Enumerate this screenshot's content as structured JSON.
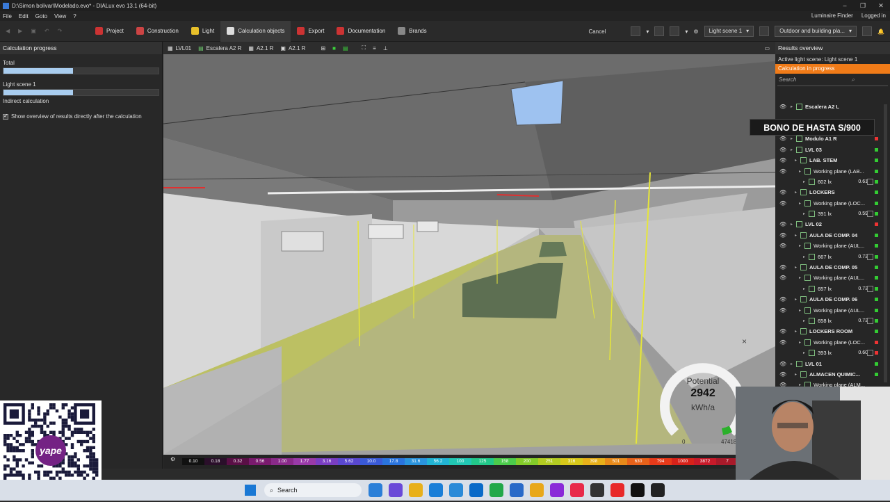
{
  "window": {
    "title": "D:\\Simon bolivar\\Modelado.evo* - DIALux evo 13.1  (64-bit)",
    "controls": [
      "–",
      "❐",
      "✕"
    ]
  },
  "menu": {
    "items": [
      "File",
      "Edit",
      "Goto",
      "View",
      "?"
    ],
    "luminaire_finder": "Luminaire Finder",
    "logged_in": "Logged in"
  },
  "toolbar": {
    "tabs": [
      {
        "label": "Project",
        "color": "#cc3333"
      },
      {
        "label": "Construction",
        "color": "#cc4444"
      },
      {
        "label": "Light",
        "color": "#e8c02a"
      },
      {
        "label": "Calculation objects",
        "color": "#dddddd"
      },
      {
        "label": "Export",
        "color": "#cc3333"
      },
      {
        "label": "Documentation",
        "color": "#cc3333"
      },
      {
        "label": "Brands",
        "color": "#888888"
      }
    ],
    "active_tab": "Calculation objects",
    "cancel": "Cancel",
    "light_scene": "Light scene 1",
    "outdoor": "Outdoor and building pla..."
  },
  "left_panel": {
    "title": "Calculation progress",
    "total_label": "Total",
    "total_progress": 0.45,
    "light_scene_label": "Light scene 1",
    "light_scene_progress": 0.45,
    "indirect_label": "Indirect calculation",
    "checkbox_label": "Show overview of results directly after the calculation"
  },
  "viewport": {
    "chips": [
      "LVL01",
      "Escalera A2 R",
      "A2.1 R",
      "A2.1 R"
    ],
    "close_glyph": "×"
  },
  "gauge": {
    "label": "Potential",
    "value": "2942",
    "unit": "kWh/a",
    "min": "0",
    "max": "47418"
  },
  "colorbar": {
    "values": [
      "0.10",
      "0.18",
      "0.32",
      "0.56",
      "1.00",
      "1.77",
      "3.16",
      "5.62",
      "10.0",
      "17.8",
      "31.6",
      "56.2",
      "100",
      "125",
      "158",
      "200",
      "251",
      "316",
      "398",
      "501",
      "630",
      "794",
      "1000",
      "3872",
      "7"
    ],
    "colors": [
      "#111111",
      "#2a0f2a",
      "#5a0f46",
      "#7a1a6e",
      "#8a2a8a",
      "#9a3aa8",
      "#7a3ec2",
      "#5a48d0",
      "#3a5ad8",
      "#2a74de",
      "#2a94de",
      "#22b4d4",
      "#22c8b4",
      "#22c88a",
      "#4ccc4c",
      "#84cc2a",
      "#b4cc22",
      "#d8c81a",
      "#e8b01a",
      "#e88a1a",
      "#e8621a",
      "#e83a1a",
      "#d8221a",
      "#c81a2a",
      "#a81a2a"
    ]
  },
  "right_panel": {
    "title": "Results overview",
    "active_scene": "Active light scene: Light scene 1",
    "calc_status": "Calculation in progress",
    "search_placeholder": "Search",
    "rows": [
      {
        "indent": 1,
        "text": "Escalera A2 L",
        "bold": true,
        "eye": true,
        "dot": ""
      },
      {
        "indent": 1,
        "text": "",
        "bold": false,
        "eye": false,
        "dot": ""
      },
      {
        "indent": 1,
        "text": "",
        "bold": false,
        "eye": false,
        "dot": ""
      },
      {
        "indent": 1,
        "text": "Modulo A1 R",
        "bold": true,
        "eye": true,
        "dot": "#ee3333"
      },
      {
        "indent": 1,
        "text": "LVL 03",
        "bold": true,
        "eye": true,
        "dot": "#33cc33"
      },
      {
        "indent": 2,
        "text": "LAB. STEM",
        "bold": true,
        "eye": true,
        "dot": "#33cc33"
      },
      {
        "indent": 3,
        "text": "Working plane (LAB...",
        "bold": false,
        "eye": true,
        "dot": "#33cc33"
      },
      {
        "indent": 4,
        "text": "602 lx",
        "ratio": "0.61",
        "bold": false,
        "eye": false,
        "dot": "#33cc33"
      },
      {
        "indent": 2,
        "text": "LOCKERS",
        "bold": true,
        "eye": true,
        "dot": "#33cc33"
      },
      {
        "indent": 3,
        "text": "Working plane (LOC...",
        "bold": false,
        "eye": true,
        "dot": "#33cc33"
      },
      {
        "indent": 4,
        "text": "391 lx",
        "ratio": "0.59",
        "bold": false,
        "eye": false,
        "dot": "#33cc33"
      },
      {
        "indent": 1,
        "text": "LVL 02",
        "bold": true,
        "eye": true,
        "dot": "#ee3333"
      },
      {
        "indent": 2,
        "text": "AULA DE COMP. 04",
        "bold": true,
        "eye": true,
        "dot": "#33cc33"
      },
      {
        "indent": 3,
        "text": "Working plane (AUL...",
        "bold": false,
        "eye": true,
        "dot": "#33cc33"
      },
      {
        "indent": 4,
        "text": "667 lx",
        "ratio": "0.73",
        "bold": false,
        "eye": false,
        "dot": "#33cc33"
      },
      {
        "indent": 2,
        "text": "AULA DE COMP. 05",
        "bold": true,
        "eye": true,
        "dot": "#33cc33"
      },
      {
        "indent": 3,
        "text": "Working plane (AUL...",
        "bold": false,
        "eye": true,
        "dot": "#33cc33"
      },
      {
        "indent": 4,
        "text": "657 lx",
        "ratio": "0.73",
        "bold": false,
        "eye": false,
        "dot": "#33cc33"
      },
      {
        "indent": 2,
        "text": "AULA DE COMP. 06",
        "bold": true,
        "eye": true,
        "dot": "#33cc33"
      },
      {
        "indent": 3,
        "text": "Working plane (AUL...",
        "bold": false,
        "eye": true,
        "dot": "#33cc33"
      },
      {
        "indent": 4,
        "text": "658 lx",
        "ratio": "0.73",
        "bold": false,
        "eye": false,
        "dot": "#33cc33"
      },
      {
        "indent": 2,
        "text": "LOCKERS ROOM",
        "bold": true,
        "eye": true,
        "dot": "#33cc33"
      },
      {
        "indent": 3,
        "text": "Working plane (LOC...",
        "bold": false,
        "eye": true,
        "dot": "#ee3333"
      },
      {
        "indent": 4,
        "text": "393 lx",
        "ratio": "0.60",
        "bold": false,
        "eye": false,
        "dot": "#ee3333"
      },
      {
        "indent": 1,
        "text": "LVL 01",
        "bold": true,
        "eye": true,
        "dot": "#33cc33"
      },
      {
        "indent": 2,
        "text": "ALMACEN QUIMIC...",
        "bold": true,
        "eye": true,
        "dot": "#33cc33"
      },
      {
        "indent": 3,
        "text": "Working plane (ALM...",
        "bold": false,
        "eye": true,
        "dot": ""
      }
    ]
  },
  "overlay": {
    "banner": "BONO DE HASTA S/900",
    "qr_logo": "yape"
  },
  "taskbar": {
    "search": "Search",
    "apps": [
      "#2a7fd8",
      "#6a4ad8",
      "#e8b01a",
      "#1a7fd8",
      "#2a8ad8",
      "#0a6ac8",
      "#22a84a",
      "#2a6ac8",
      "#e8a81a",
      "#8a2ad8",
      "#e82a4a",
      "#333333",
      "#e82a2a",
      "#111111",
      "#222222"
    ]
  }
}
